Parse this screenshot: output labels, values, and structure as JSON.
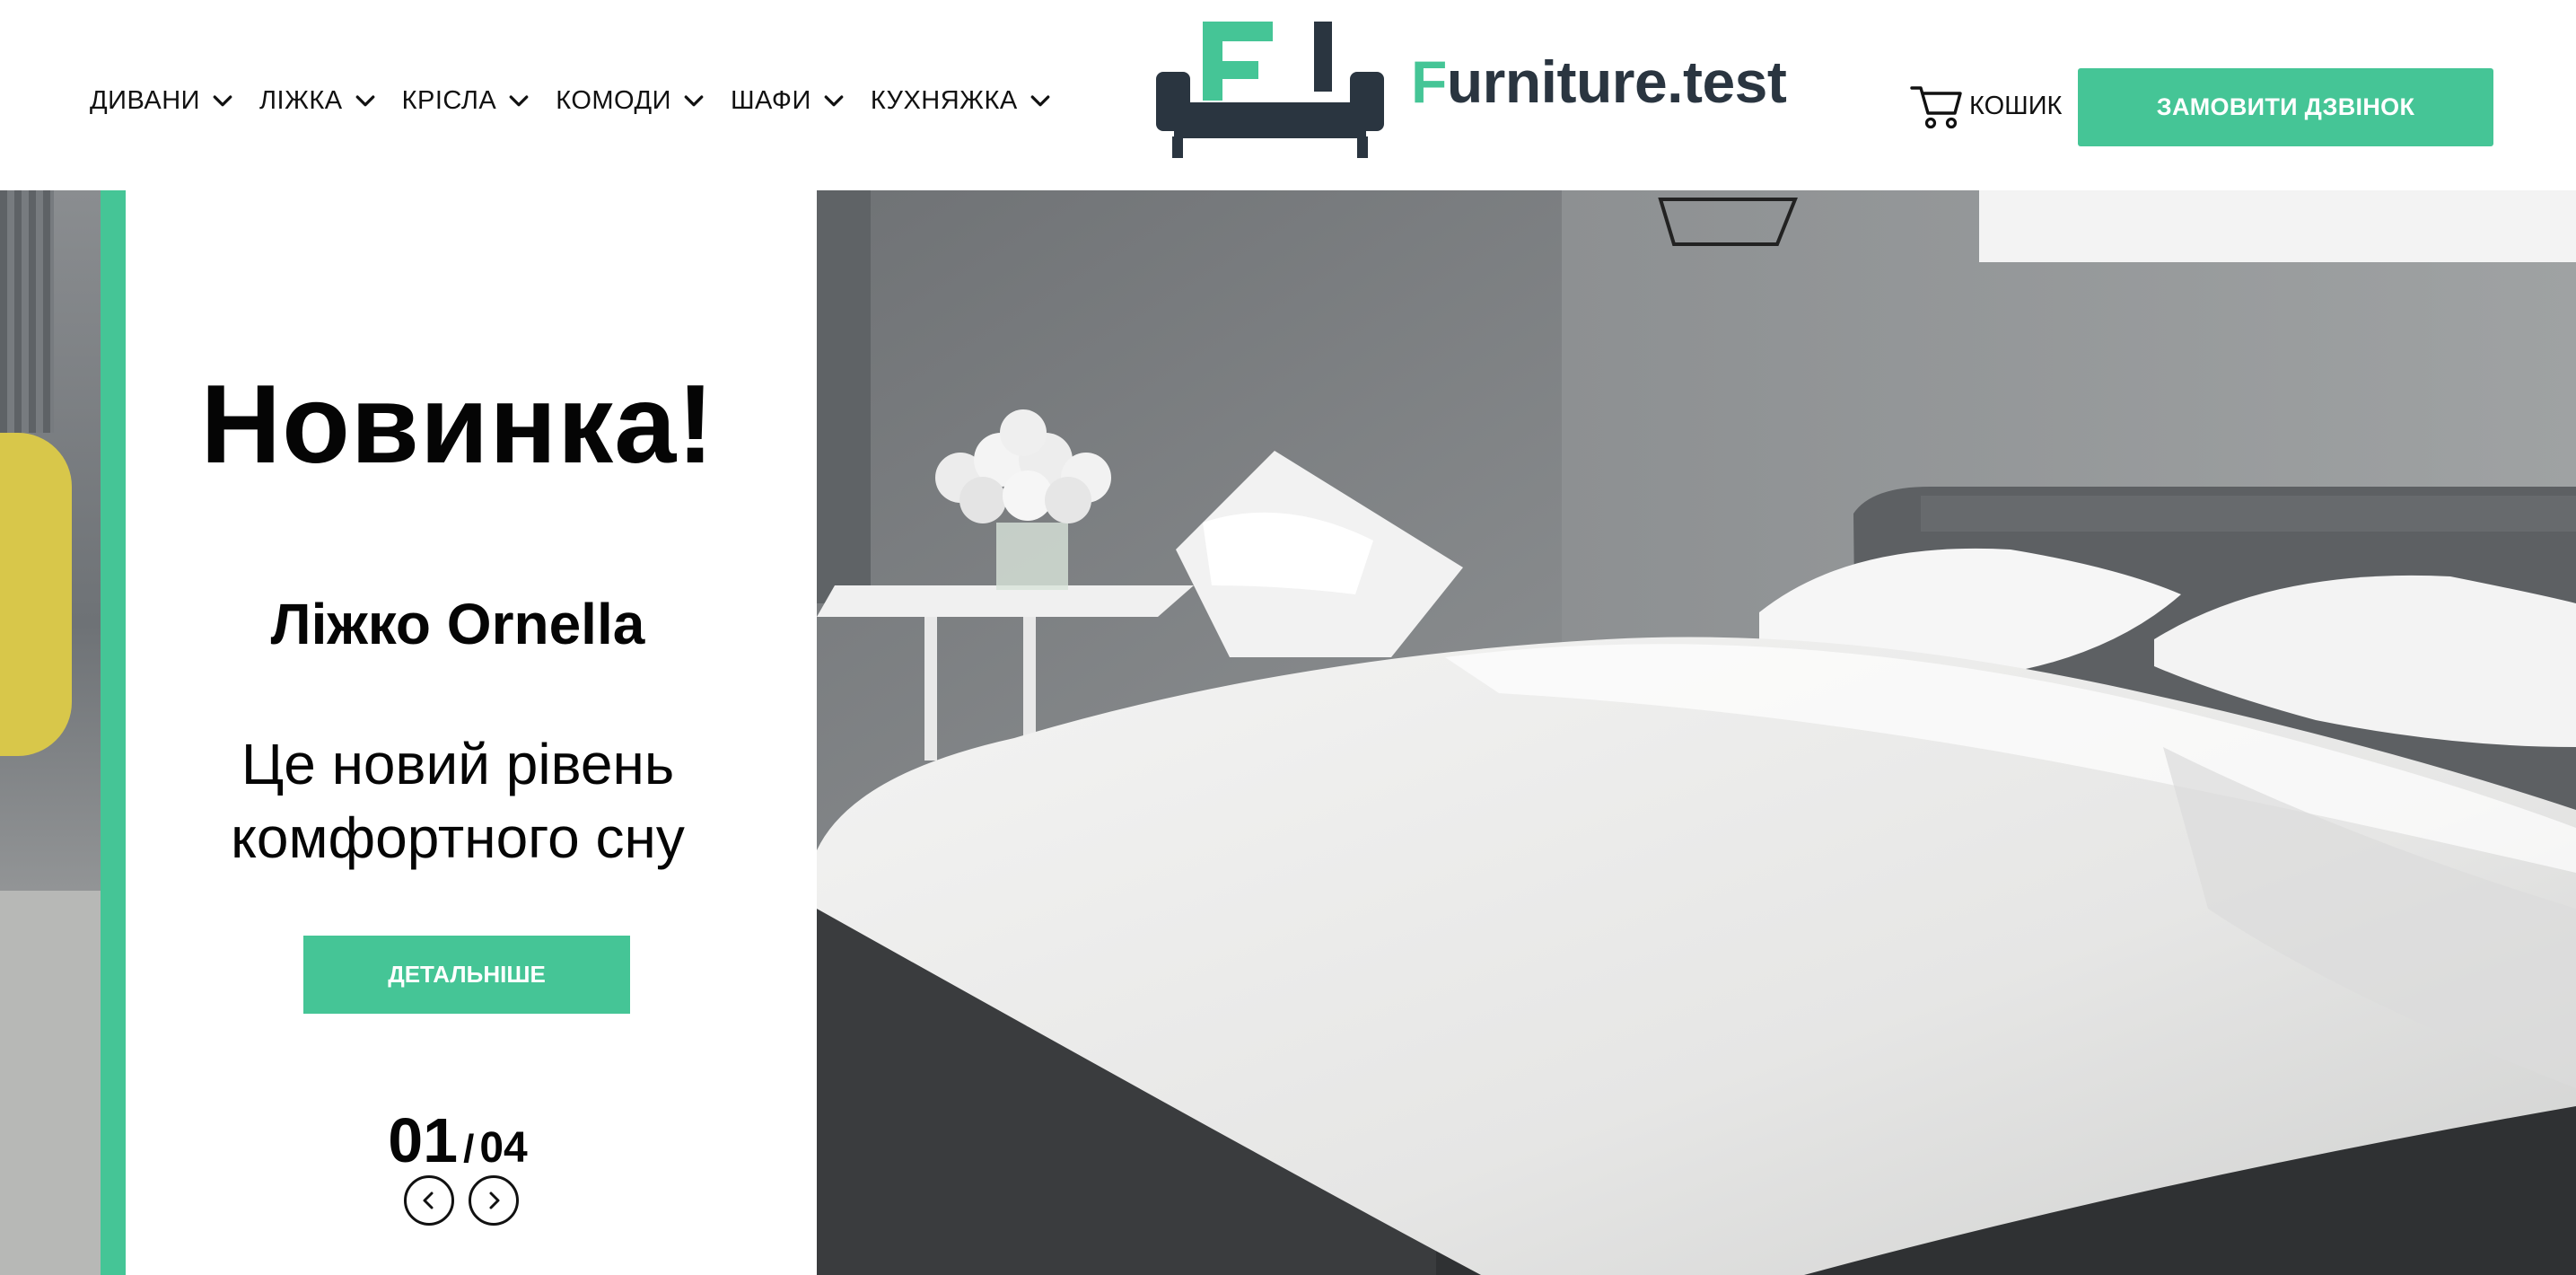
{
  "nav": {
    "items": [
      {
        "label": "ДИВАНИ",
        "icon": "chevron-down-icon"
      },
      {
        "label": "ЛІЖКА",
        "icon": "chevron-down-icon"
      },
      {
        "label": "КРІСЛА",
        "icon": "chevron-down-icon"
      },
      {
        "label": "КОМОДИ",
        "icon": "chevron-down-icon"
      },
      {
        "label": "ШАФИ",
        "icon": "chevron-down-icon"
      },
      {
        "label": "КУХНЯЖКА",
        "icon": "chevron-down-icon"
      }
    ]
  },
  "logo": {
    "text_accent": "F",
    "text_rest": "urniture.test",
    "icon": "sofa-logo-icon"
  },
  "cart": {
    "label": "КОШИК",
    "icon": "cart-icon"
  },
  "header": {
    "call_button": "ЗАМОВИТИ ДЗВІНОК"
  },
  "hero": {
    "badge": "Новинка!",
    "product": "Ліжко Ornella",
    "tagline_line1": "Це новий рівень",
    "tagline_line2": "комфортного сну",
    "more_button": "ДЕТАЛЬНІШЕ",
    "slide_current": "01",
    "slide_separator": "/",
    "slide_total": "04",
    "prev_icon": "chevron-left-icon",
    "next_icon": "chevron-right-icon",
    "image": "bedroom-photo"
  },
  "colors": {
    "accent": "#45c596",
    "logo_dark": "#2a3540",
    "text": "#111111"
  }
}
